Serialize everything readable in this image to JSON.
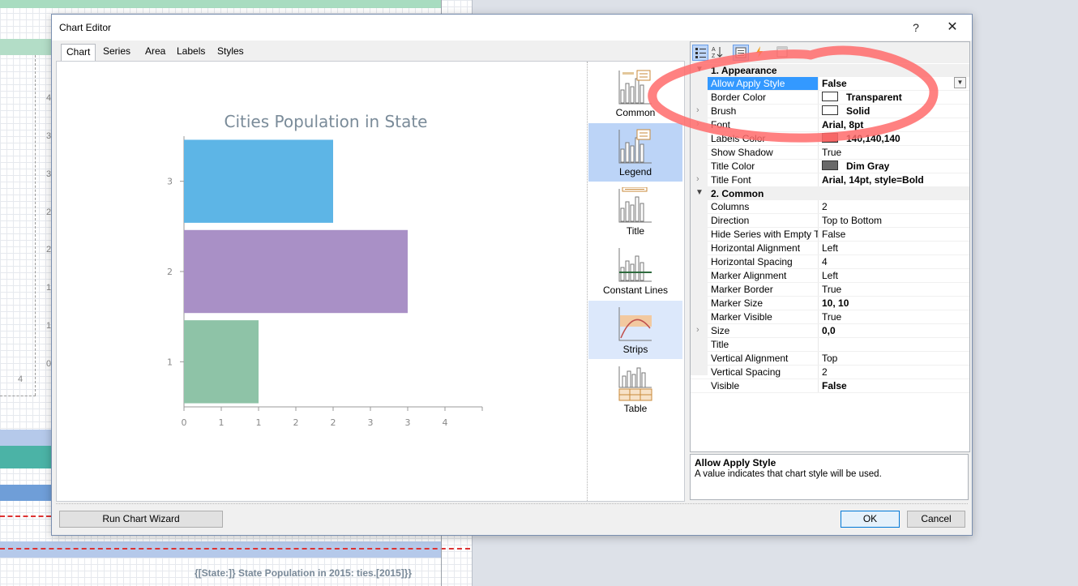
{
  "background": {
    "footer_expression": "{[State:]} State Population in 2015: ties.[2015]}}",
    "ruler_labels": [
      "4",
      "3",
      "3",
      "2",
      "2",
      "1",
      "1",
      "0",
      "4"
    ]
  },
  "dialog": {
    "title": "Chart Editor",
    "help_glyph": "?",
    "close_glyph": "✕",
    "tabs": [
      {
        "label": "Chart",
        "active": true
      },
      {
        "label": "Series",
        "active": false
      },
      {
        "label": "Area",
        "active": false
      },
      {
        "label": "Labels",
        "active": false
      },
      {
        "label": "Styles",
        "active": false
      }
    ],
    "elements": [
      {
        "label": "Common",
        "state": "normal",
        "icon": "common-chart-icon"
      },
      {
        "label": "Legend",
        "state": "selected",
        "icon": "legend-chart-icon"
      },
      {
        "label": "Title",
        "state": "normal",
        "icon": "title-chart-icon"
      },
      {
        "label": "Constant Lines",
        "state": "normal",
        "icon": "constant-lines-chart-icon"
      },
      {
        "label": "Strips",
        "state": "hover",
        "icon": "strips-chart-icon"
      },
      {
        "label": "Table",
        "state": "normal",
        "icon": "table-chart-icon"
      }
    ],
    "buttons": {
      "wizard": "Run Chart Wizard",
      "ok": "OK",
      "cancel": "Cancel"
    }
  },
  "chart_data": {
    "type": "bar",
    "orientation": "horizontal",
    "title": "Cities Population in State",
    "categories": [
      "1",
      "2",
      "3"
    ],
    "values": [
      1,
      3,
      2
    ],
    "colors": [
      "#8ec3a7",
      "#a990c6",
      "#5db5e6"
    ],
    "xlim": [
      0,
      4
    ],
    "x_ticks": [
      "0",
      "1",
      "1",
      "2",
      "2",
      "3",
      "3",
      "4"
    ],
    "x_tick_values": [
      0,
      0.5,
      1,
      1.5,
      2,
      2.5,
      3,
      3.5
    ],
    "title_color": "#7a8b99",
    "grid": false
  },
  "property_grid": {
    "categories": [
      {
        "name": "1. Appearance",
        "items": [
          {
            "name": "Allow Apply Style",
            "value": "False",
            "bold": true,
            "selected": true,
            "dropdown": true
          },
          {
            "name": "Border Color",
            "value": "Transparent",
            "bold": true,
            "swatch": "#ffffff"
          },
          {
            "name": "Brush",
            "value": "Solid",
            "bold": true,
            "swatch": "#ffffff",
            "expandable": true
          },
          {
            "name": "Font",
            "value": "Arial, 8pt",
            "bold": true,
            "expandable": true
          },
          {
            "name": "Labels Color",
            "value": "140,140,140",
            "bold": true,
            "swatch": "#c65454"
          },
          {
            "name": "Show Shadow",
            "value": "True",
            "bold": false
          },
          {
            "name": "Title Color",
            "value": "Dim Gray",
            "bold": true,
            "swatch": "#696969"
          },
          {
            "name": "Title Font",
            "value": "Arial, 14pt, style=Bold",
            "bold": true,
            "expandable": true
          }
        ]
      },
      {
        "name": "2. Common",
        "items": [
          {
            "name": "Columns",
            "value": "2",
            "bold": false
          },
          {
            "name": "Direction",
            "value": "Top to Bottom",
            "bold": false
          },
          {
            "name": "Hide Series with Empty Title",
            "value": "False",
            "bold": false
          },
          {
            "name": "Horizontal Alignment",
            "value": "Left",
            "bold": false
          },
          {
            "name": "Horizontal Spacing",
            "value": "4",
            "bold": false
          },
          {
            "name": "Marker Alignment",
            "value": "Left",
            "bold": false
          },
          {
            "name": "Marker Border",
            "value": "True",
            "bold": false
          },
          {
            "name": "Marker Size",
            "value": "10, 10",
            "bold": true
          },
          {
            "name": "Marker Visible",
            "value": "True",
            "bold": false
          },
          {
            "name": "Size",
            "value": "0,0",
            "bold": true,
            "expandable": true
          },
          {
            "name": "Title",
            "value": "",
            "bold": false
          },
          {
            "name": "Vertical Alignment",
            "value": "Top",
            "bold": false
          },
          {
            "name": "Vertical Spacing",
            "value": "2",
            "bold": false
          },
          {
            "name": "Visible",
            "value": "False",
            "bold": true
          }
        ]
      }
    ],
    "description_title": "Allow Apply Style",
    "description_text": "A value indicates that chart style will be used."
  },
  "colors": {
    "selection": "#3399ff",
    "element_selected": "#bcd4f7",
    "annotation": "#ff6b6b"
  }
}
